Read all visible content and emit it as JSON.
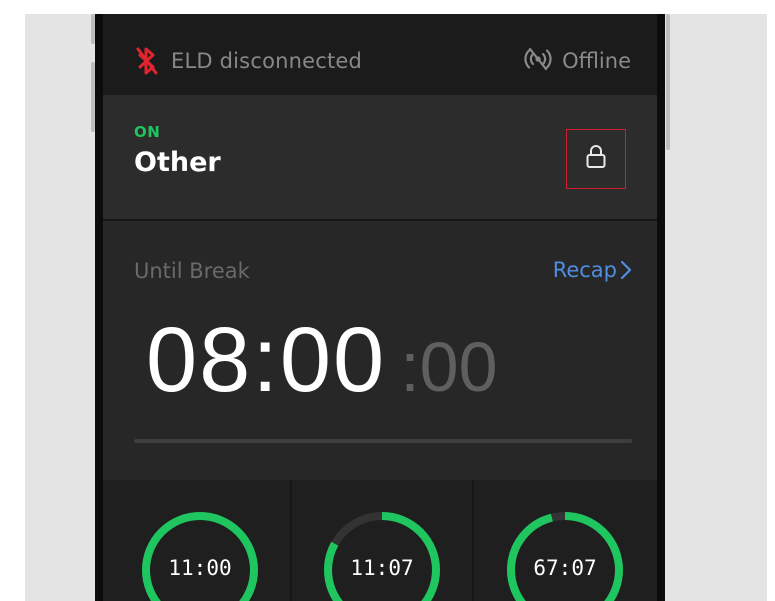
{
  "status_bar": {
    "eld_status": "ELD disconnected",
    "eld_icon": "bluetooth-disabled-icon",
    "network_status": "Offline",
    "network_icon": "broadcast-off-icon"
  },
  "duty_status": {
    "state": "ON",
    "name": "Other",
    "lock_icon": "lock-icon"
  },
  "break_timer": {
    "label": "Until Break",
    "recap_label": "Recap",
    "time_main": "08:00",
    "time_seconds": ":00"
  },
  "gauges": [
    {
      "value": "11:00",
      "fill_fraction": 1.0
    },
    {
      "value": "11:07",
      "fill_fraction": 0.83
    },
    {
      "value": "67:07",
      "fill_fraction": 0.96
    }
  ],
  "colors": {
    "accent_green": "#1fc65f",
    "link_blue": "#4f8ee0",
    "alert_red": "#e0242c"
  }
}
